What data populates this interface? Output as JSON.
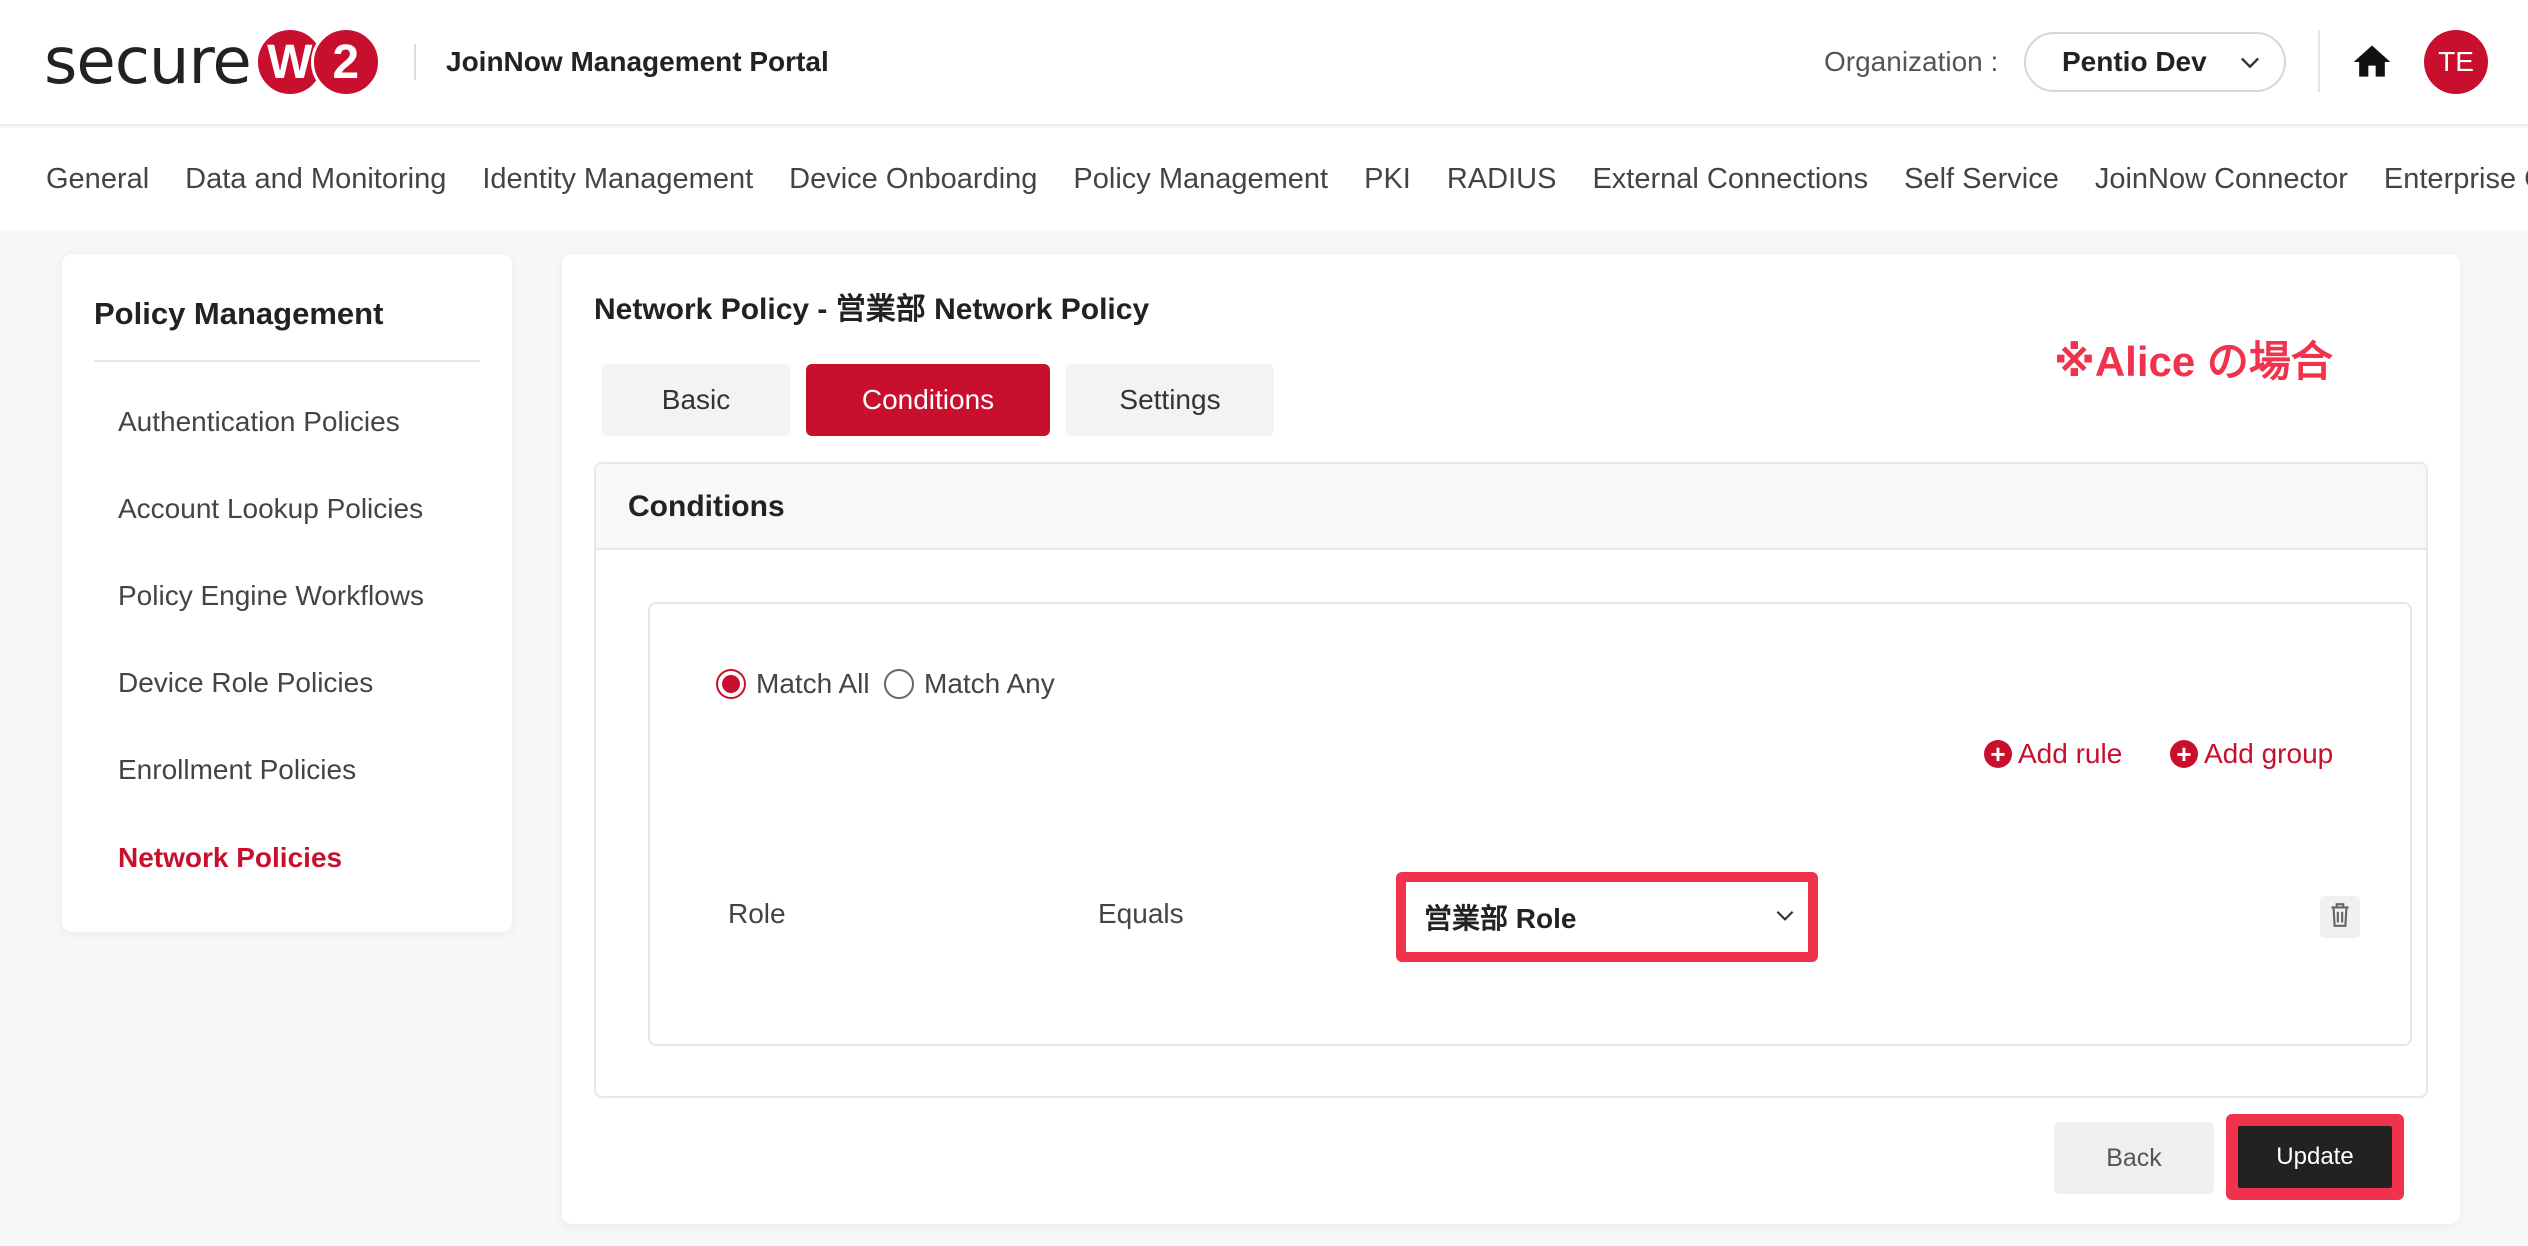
{
  "header": {
    "logo_text": "secure",
    "logo_letters": [
      "W",
      "2"
    ],
    "portal_title": "JoinNow Management Portal",
    "org_label": "Organization :",
    "org_value": "Pentio Dev",
    "avatar_initials": "TE",
    "icons": {
      "org_dropdown": "chevron-down-icon",
      "home": "home-icon"
    }
  },
  "nav": {
    "items": [
      "General",
      "Data and Monitoring",
      "Identity Management",
      "Device Onboarding",
      "Policy Management",
      "PKI",
      "RADIUS",
      "External Connections",
      "Self Service",
      "JoinNow Connector",
      "Enterprise Client"
    ]
  },
  "sidebar": {
    "title": "Policy Management",
    "items": [
      "Authentication Policies",
      "Account Lookup Policies",
      "Policy Engine Workflows",
      "Device Role Policies",
      "Enrollment Policies",
      "Network Policies"
    ],
    "active_item": "Network Policies"
  },
  "main": {
    "page_title": "Network Policy - 営業部 Network Policy",
    "annotation": "※Alice の場合",
    "tabs": [
      "Basic",
      "Conditions",
      "Settings"
    ],
    "active_tab": "Conditions",
    "panel_title": "Conditions",
    "match_options": [
      "Match All",
      "Match Any"
    ],
    "match_selected": "Match All",
    "add_rule": "Add rule",
    "add_group": "Add group",
    "rule": {
      "field": "Role",
      "operator": "Equals",
      "value": "営業部 Role"
    },
    "icons": {
      "add": "plus-circle-icon",
      "delete": "trash-icon",
      "select": "chevron-down-icon"
    },
    "back_button": "Back",
    "update_button": "Update"
  },
  "colors": {
    "brand_red": "#c8102e",
    "highlight_red": "#f0324c",
    "dark_button": "#222222"
  }
}
